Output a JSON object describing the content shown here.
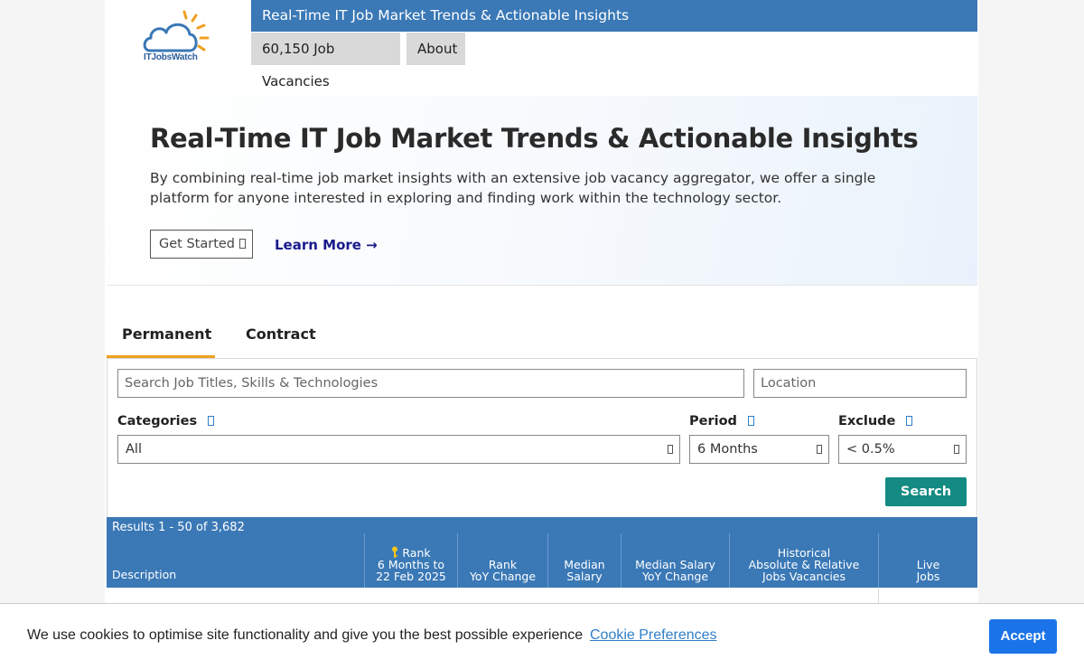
{
  "brand": {
    "logo_text": "ITJobsWatch",
    "color": "#3a78b6"
  },
  "header": {
    "title": "Real-Time IT Job Market Trends & Actionable Insights",
    "nav": [
      {
        "label": "60,150 Job Vacancies"
      },
      {
        "label": "About"
      }
    ]
  },
  "hero": {
    "heading": "Real-Time IT Job Market Trends & Actionable Insights",
    "description": "By combining real-time job market insights with an extensive job vacancy aggregator, we offer a single platform for anyone interested in exploring and finding work within the technology sector.",
    "get_started_label": "Get Started",
    "learn_more_label": "Learn More →"
  },
  "tabs": [
    {
      "label": "Permanent",
      "active": true
    },
    {
      "label": "Contract",
      "active": false
    }
  ],
  "search": {
    "query_placeholder": "Search Job Titles, Skills & Technologies",
    "location_placeholder": "Location",
    "categories_label": "Categories",
    "categories_value": "All",
    "period_label": "Period",
    "period_value": "6 Months",
    "exclude_label": "Exclude",
    "exclude_value": "< 0.5%",
    "search_button": "Search",
    "button_color": "#138a82"
  },
  "results": {
    "count_text": "Results 1 - 50 of 3,682",
    "columns": {
      "description": "Description",
      "rank": [
        "Rank",
        "6 Months to",
        "22 Feb 2025"
      ],
      "rank_yoy": [
        "Rank",
        "YoY Change"
      ],
      "median_salary": [
        "Median",
        "Salary"
      ],
      "median_salary_yoy": [
        "Median Salary",
        "YoY Change"
      ],
      "historical": [
        "Historical",
        "Absolute & Relative",
        "Jobs Vacancies"
      ],
      "live_jobs": [
        "Live",
        "Jobs"
      ]
    }
  },
  "cookie": {
    "message": "We use cookies to optimise site functionality and give you the best possible experience",
    "preferences_link": "Cookie Preferences",
    "accept_button": "Accept",
    "accept_color": "#1a73e8"
  }
}
